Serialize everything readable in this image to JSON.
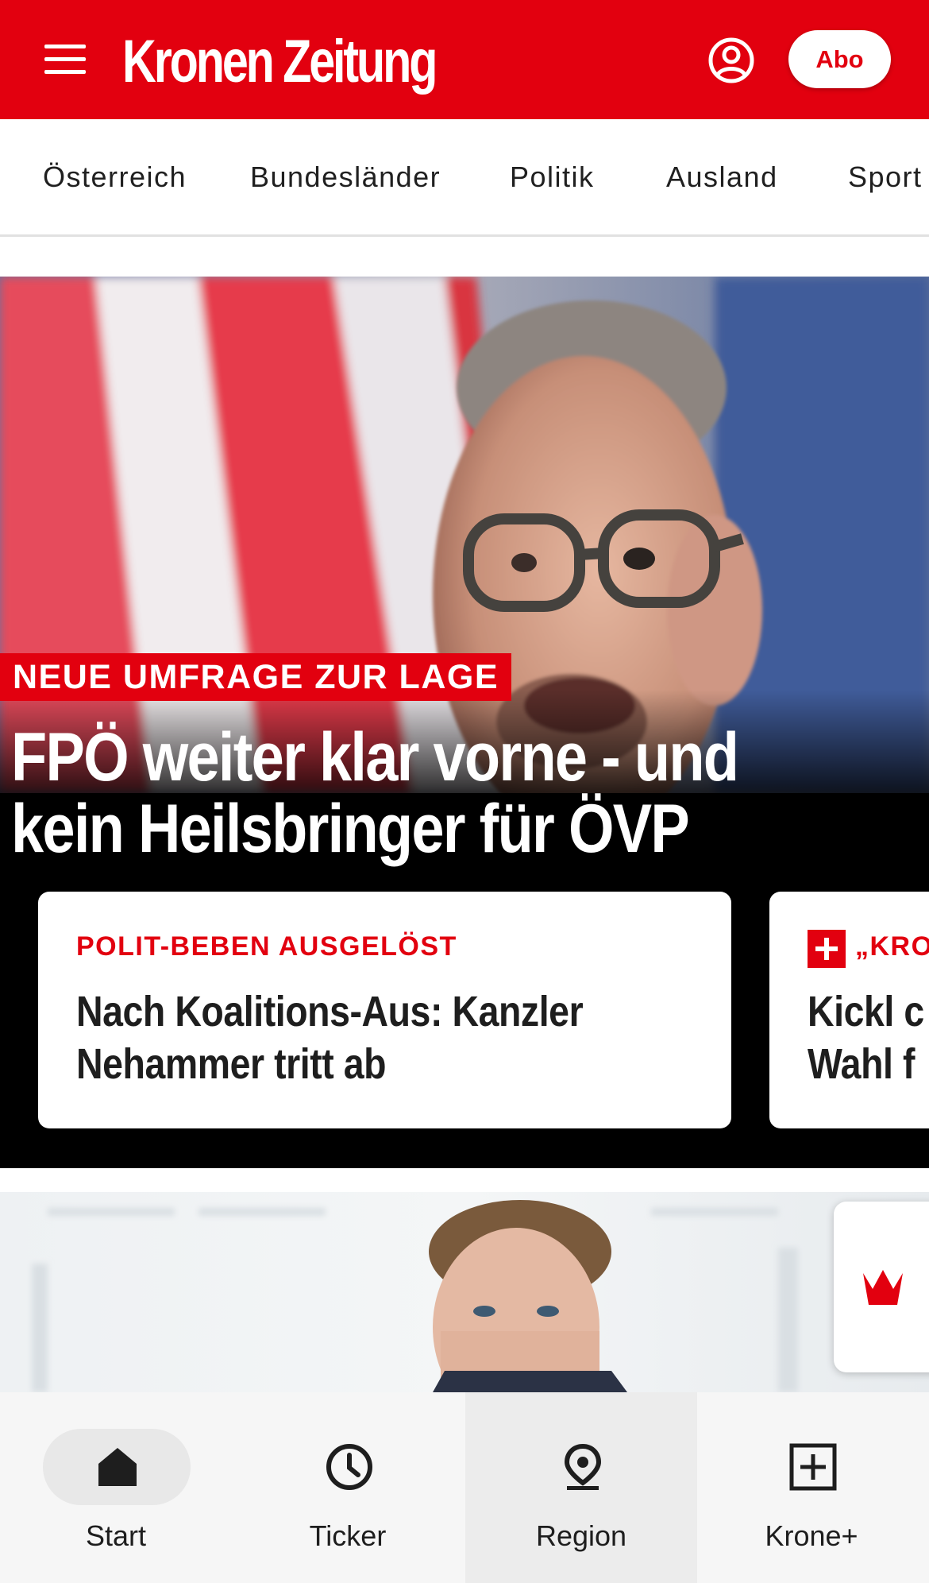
{
  "header": {
    "logo_text": "Kronen Zeitung",
    "abo_label": "Abo",
    "brand_color": "#e2000f",
    "icons": [
      "menu-icon",
      "account-icon"
    ]
  },
  "categories": [
    "Österreich",
    "Bundesländer",
    "Politik",
    "Ausland",
    "Sport"
  ],
  "hero": {
    "kicker": "NEUE UMFRAGE ZUR LAGE",
    "headline_line1": "FPÖ weiter klar vorne - und",
    "headline_line2": "kein Heilsbringer für ÖVP"
  },
  "teasers": [
    {
      "kicker": "POLIT-BEBEN AUSGELÖST",
      "title_line1": "Nach Koalitions-Aus: Kanzler",
      "title_line2": "Nehammer tritt ab"
    },
    {
      "kicker": "„KRO",
      "title_line1": "Kickl c",
      "title_line2": "Wahl f",
      "badge_icon": "plus-badge-icon"
    }
  ],
  "widget": {
    "icon": "crown-icon"
  },
  "bottom_nav": [
    {
      "label": "Start",
      "icon": "home-icon",
      "active": true
    },
    {
      "label": "Ticker",
      "icon": "clock-icon",
      "active": false
    },
    {
      "label": "Region",
      "icon": "location-pin-icon",
      "active": false
    },
    {
      "label": "Krone+",
      "icon": "plus-square-icon",
      "active": false
    }
  ]
}
